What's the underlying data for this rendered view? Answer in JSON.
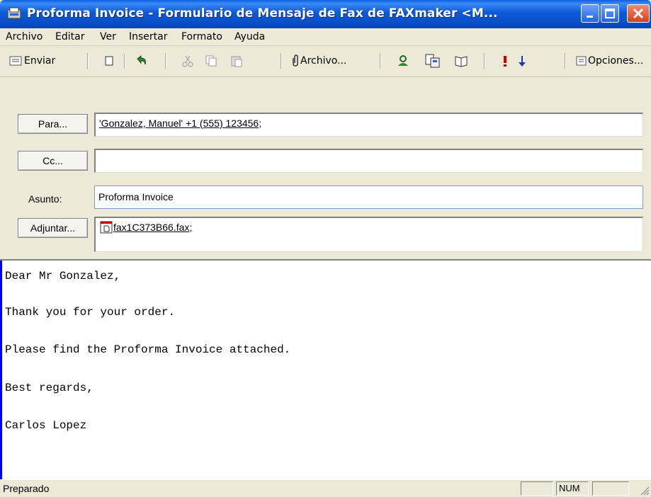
{
  "window": {
    "title": "Proforma Invoice - Formulario de Mensaje de Fax de FAXmaker <M...",
    "controls": [
      "minimize-icon",
      "maximize-icon",
      "close-icon"
    ]
  },
  "menu": {
    "items": [
      "Archivo",
      "Editar",
      "Ver",
      "Insertar",
      "Formato",
      "Ayuda"
    ]
  },
  "toolbar": {
    "send_label": "Enviar",
    "attach_label": "Archivo...",
    "options_label": "Opciones...",
    "icons": [
      "send-icon",
      "new-icon",
      "undo-icon",
      "cut-icon",
      "copy-icon",
      "paste-icon",
      "paperclip-icon",
      "address-book-icon",
      "check-names-icon",
      "book-icon",
      "high-priority-icon",
      "low-priority-icon",
      "options-icon"
    ]
  },
  "header": {
    "to_button": "Para...",
    "to_value": "'Gonzalez, Manuel' +1 (555) 123456;",
    "cc_button": "Cc...",
    "cc_value": "",
    "subject_label": "Asunto:",
    "subject_value": "Proforma Invoice",
    "attach_button": "Adjuntar...",
    "attachment_name": "fax1C373B66.fax;"
  },
  "body": {
    "lines": [
      "Dear Mr Gonzalez,",
      "Thank you for your order.",
      "Please find the Proforma Invoice attached.",
      "Best regards,",
      "Carlos Lopez"
    ]
  },
  "status": {
    "text": "Preparado",
    "num": "NUM"
  },
  "colors": {
    "titlebar": "#0a4fc8",
    "chrome": "#ece9d8",
    "field_border": "#7f9db9"
  }
}
